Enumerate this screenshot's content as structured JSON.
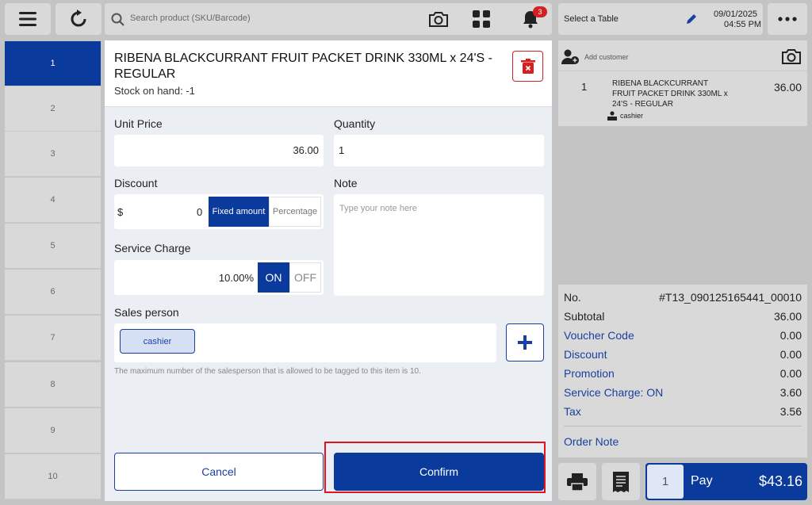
{
  "topbar": {
    "search_placeholder": "Search product (SKU/Barcode)",
    "notification_count": "3",
    "table_label": "Select a Table",
    "date": "09/01/2025",
    "time": "04:55 PM"
  },
  "tables": [
    "1",
    "2",
    "3",
    "4",
    "5",
    "6",
    "7",
    "8",
    "9",
    "10"
  ],
  "modal": {
    "product_title": "RIBENA BLACKCURRANT FRUIT PACKET DRINK 330ML x 24'S - REGULAR",
    "stock": "Stock on hand: -1",
    "unit_price_label": "Unit Price",
    "unit_price": "36.00",
    "quantity_label": "Quantity",
    "quantity": "1",
    "discount_label": "Discount",
    "discount_currency": "$",
    "discount_value": "0",
    "fixed_amount_label": "Fixed amount",
    "percentage_label": "Percentage",
    "note_label": "Note",
    "note_placeholder": "Type your note here",
    "service_charge_label": "Service Charge",
    "service_charge_value": "10.00%",
    "on_label": "ON",
    "off_label": "OFF",
    "sales_person_label": "Sales person",
    "sales_person_chip": "cashier",
    "sales_person_hint": "The maximum number of the salesperson that is allowed to be tagged to this item is 10.",
    "cancel_label": "Cancel",
    "confirm_label": "Confirm"
  },
  "cart": {
    "add_customer": "Add customer",
    "line_qty": "1",
    "line_name": "RIBENA BLACKCURRANT FRUIT PACKET DRINK 330ML x 24'S - REGULAR",
    "line_price": "36.00",
    "line_salesperson": "cashier"
  },
  "summary": {
    "no_label": "No.",
    "no_value": "#T13_090125165441_00010",
    "subtotal_label": "Subtotal",
    "subtotal": "36.00",
    "voucher_label": "Voucher Code",
    "voucher": "0.00",
    "discount_label": "Discount",
    "discount": "0.00",
    "promotion_label": "Promotion",
    "promotion": "0.00",
    "service_label": "Service Charge: ON",
    "service": "3.60",
    "tax_label": "Tax",
    "tax": "3.56",
    "order_note_label": "Order Note"
  },
  "pay": {
    "qty": "1",
    "label": "Pay",
    "amount": "$43.16"
  },
  "colors": {
    "primary": "#0a3a9c",
    "badge": "#d32020",
    "highlight": "#e0141e"
  }
}
